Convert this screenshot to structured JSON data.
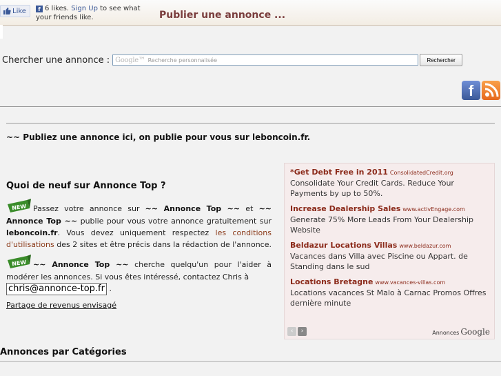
{
  "topbar": {
    "like_label": "Like",
    "likes_text": "6 likes.",
    "signup_link": "Sign Up",
    "signup_suffix": "to see what your friends like.",
    "page_title": "Publier une annonce ..."
  },
  "search": {
    "label": "Chercher une annonce :",
    "google_mark": "Google™",
    "placeholder": "Recherche personnalisée",
    "button_label": "Rechercher"
  },
  "social": {
    "facebook_icon": "facebook-icon",
    "rss_icon": "rss-icon"
  },
  "intro": "~~ Publiez une annonce ici, on publie pour vous sur leboncoin.fr.",
  "news": {
    "title": "Quoi de neuf sur Annonce Top ?",
    "badge": "NEW",
    "p1_a": "Passez votre annonce sur ",
    "p1_b": "~~ Annonce Top ~~",
    "p1_c": " et ",
    "p1_d": "~~ Annonce Top ~~",
    "p1_e": " publie pour vous votre annonce gratuitement sur ",
    "p1_f": "leboncoin.fr",
    "p1_g": ". Vous devez uniquement respectez ",
    "p1_link": "les conditions d'utilisations",
    "p1_h": " des 2 sites et être précis dans la rédaction de l'annonce.",
    "p2_a": "~~ Annonce Top ~~",
    "p2_b": " cherche quelqu'un pour l'aider à modérer les annonces. Si vous êtes intéressé, contactez Chris à",
    "email": "chris@annonce-top.fr",
    "p2_end": ".",
    "revenue_link": "Partage de revenus envisagé"
  },
  "ads": {
    "items": [
      {
        "title": "*Get Debt Free in 2011",
        "url": "ConsolidatedCredit.org",
        "text": "Consolidate Your Credit Cards. Reduce Your Payments by up to 50%."
      },
      {
        "title": "Increase Dealership Sales",
        "url": "www.activEngage.com",
        "text": "Generate 75% More Leads From Your Dealership Website"
      },
      {
        "title": "Beldazur Locations Villas",
        "url": "www.beldazur.com",
        "text": "Vacances dans Villa avec Piscine ou Appart. de Standing dans le sud"
      },
      {
        "title": "Locations Bretagne",
        "url": "www.vacances-villas.com",
        "text": "Locations vacances St Malo à Carnac Promos Offres dernière minute"
      }
    ],
    "prev": "‹",
    "next": "›",
    "ads_by": "Annonces",
    "google": "Google"
  },
  "categories_title": "Annonces par Catégories"
}
